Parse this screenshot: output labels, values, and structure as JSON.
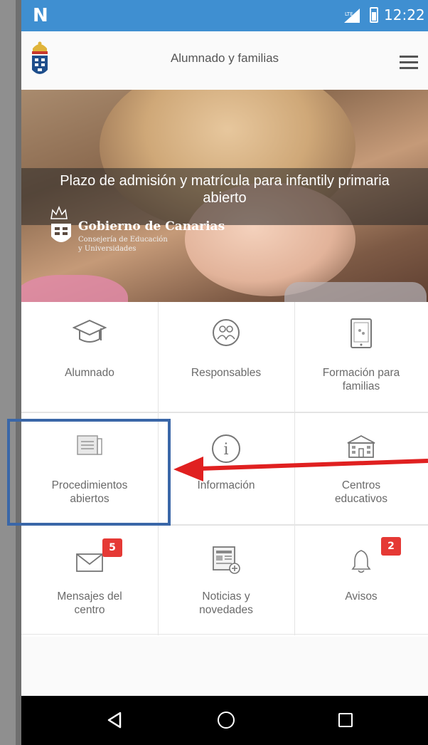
{
  "status_bar": {
    "time": "12:22",
    "icons": [
      "nfc-icon",
      "signal-icon",
      "battery-icon"
    ]
  },
  "header": {
    "title": "Alumnado y familias",
    "icons": [
      "coat-of-arms-logo",
      "menu-icon"
    ]
  },
  "banner": {
    "caption_line1": "Plazo de admisión y matrícula para infantily primaria",
    "caption_line2": "abierto",
    "org_title": "Gobierno de Canarias",
    "org_subtitle_1": "Consejería de Educación",
    "org_subtitle_2": "y Universidades"
  },
  "tiles": [
    {
      "label_1": "Alumnado",
      "label_2": "",
      "icon": "graduation-cap-icon"
    },
    {
      "label_1": "Responsables",
      "label_2": "",
      "icon": "family-icon"
    },
    {
      "label_1": "Formación para",
      "label_2": "familias",
      "icon": "tablet-icon"
    },
    {
      "label_1": "Procedimientos",
      "label_2": "abiertos",
      "icon": "document-icon"
    },
    {
      "label_1": "Información",
      "label_2": "",
      "icon": "info-icon"
    },
    {
      "label_1": "Centros",
      "label_2": "educativos",
      "icon": "school-icon"
    },
    {
      "label_1": "Mensajes del",
      "label_2": "centro",
      "icon": "envelope-icon",
      "badge": "5"
    },
    {
      "label_1": "Noticias y",
      "label_2": "novedades",
      "icon": "newspaper-icon"
    },
    {
      "label_1": "Avisos",
      "label_2": "",
      "icon": "bell-icon",
      "badge": "2"
    }
  ],
  "nav_bar": {
    "icons": [
      "back-icon",
      "home-icon",
      "recents-icon"
    ]
  },
  "colors": {
    "status_bar": "#3f8fd1",
    "badge": "#e53935",
    "highlight": "#3a67a8",
    "arrow": "#e02020"
  }
}
